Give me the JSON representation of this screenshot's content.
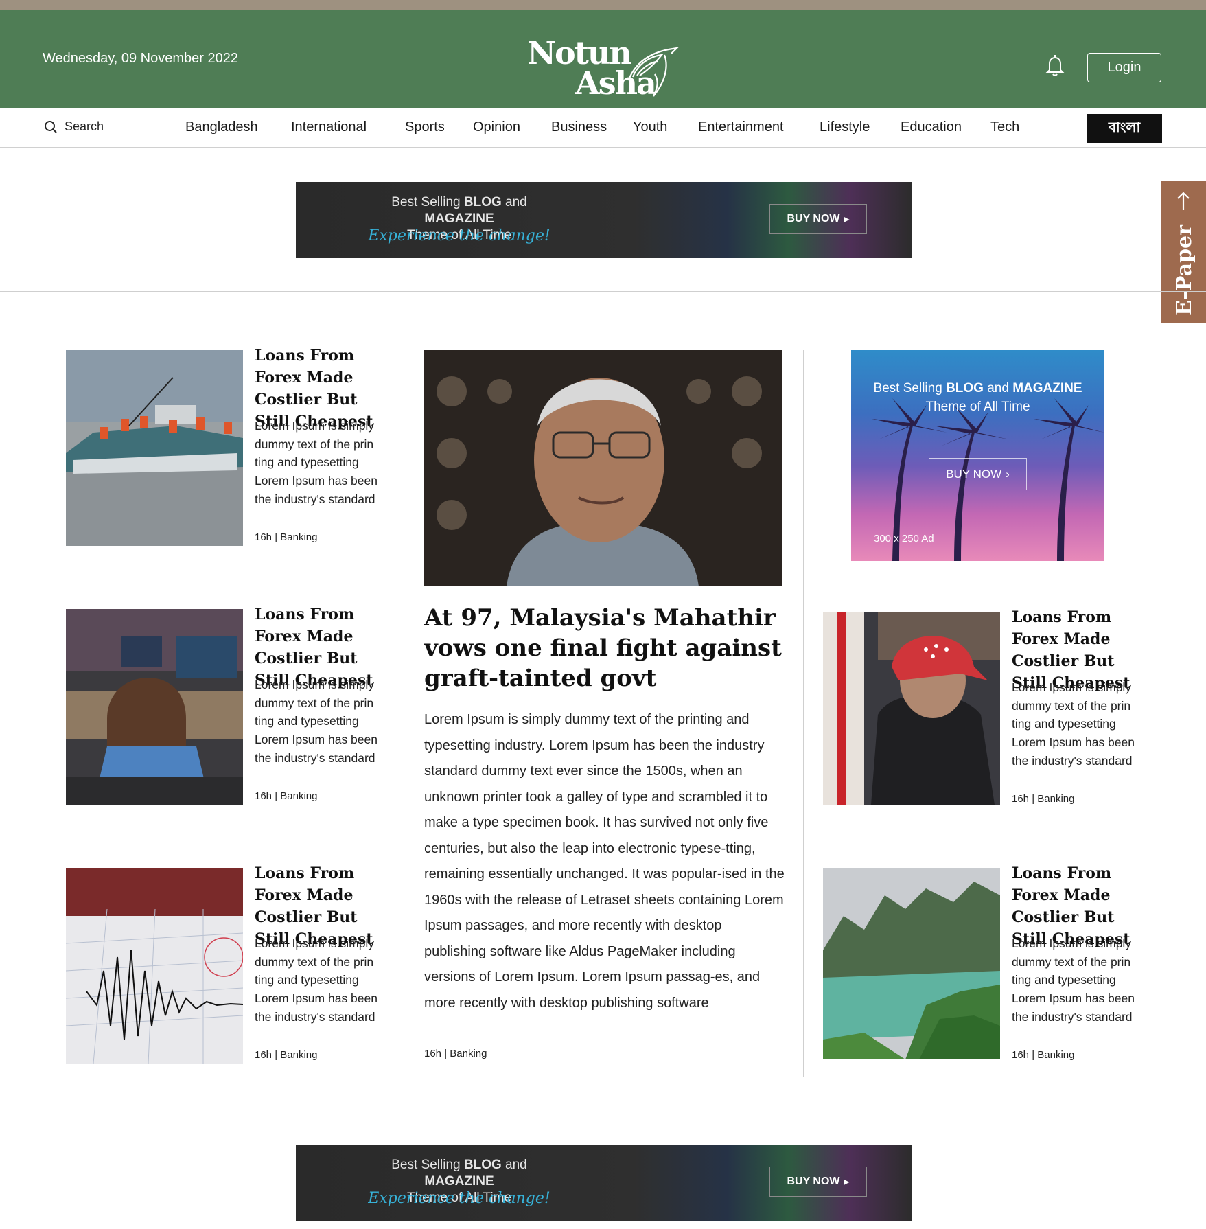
{
  "header": {
    "date": "Wednesday, 09 November 2022",
    "logo_line1": "Notun",
    "logo_line2": "Asha",
    "login_label": "Login",
    "bg_color": "#4f7d55"
  },
  "navbar": {
    "search_label": "Search",
    "items": [
      "Bangladesh",
      "International",
      "Sports",
      "Opinion",
      "Business",
      "Youth",
      "Entertainment",
      "Lifestyle",
      "Education",
      "Tech"
    ],
    "lang_button": "বাংলা"
  },
  "epaper": {
    "label": "E-Paper",
    "bg_color": "#9e6a4e"
  },
  "banner": {
    "line1_pre": "Best Selling ",
    "line1_b1": "BLOG",
    "line1_mid": " and ",
    "line1_b2": "MAGAZINE",
    "line2": "Theme of All Time",
    "tagline": "Experience the change!",
    "button": "BUY NOW"
  },
  "ad_300": {
    "line1_pre": "Best Selling ",
    "line1_b1": "BLOG",
    "line1_mid": " and ",
    "line1_b2": "MAGAZINE",
    "line2": "Theme of All Time",
    "button": "BUY NOW",
    "size_label": "300 x 250 Ad"
  },
  "lead": {
    "title": "At 97, Malaysia's Mahathir vows one final fight against graft-tainted govt",
    "body": "Lorem Ipsum is simply dummy text of the printing and typesetting industry. Lorem Ipsum has been the industry standard dummy text ever since the 1500s, when an unknown printer took a galley of type and scrambled it to make a type specimen book. It has survived not only five centuries, but also the leap into electronic typese-tting, remaining essentially unchanged. It was popular-ised in the 1960s with the release of Letraset sheets containing Lorem Ipsum passages, and more recently with desktop publishing software like Aldus PageMaker including versions of Lorem Ipsum. Lorem Ipsum passag-es, and more recently with desktop publishing software",
    "meta": "16h  |  Banking"
  },
  "cards": [
    {
      "title": "Loans From Forex Made Costlier But Still Cheapest",
      "excerpt": "Lorem Ipsum is simply dummy text of the prin ting  and typesetting Lorem Ipsum has been the industry's standard",
      "meta": "16h  |  Banking"
    },
    {
      "title": "Loans From Forex Made Costlier But Still Cheapest",
      "excerpt": "Lorem Ipsum is simply dummy text of the prin ting  and typesetting Lorem Ipsum has been the industry's standard",
      "meta": "16h  |  Banking"
    },
    {
      "title": "Loans From Forex Made Costlier But Still Cheapest",
      "excerpt": "Lorem Ipsum is simply dummy text of the prin ting  and typesetting Lorem Ipsum has been the industry's standard",
      "meta": "16h  |  Banking"
    },
    {
      "title": "Loans From Forex Made Costlier But Still Cheapest",
      "excerpt": "Lorem Ipsum is simply dummy text of the prin ting  and typesetting Lorem Ipsum has been the industry's standard",
      "meta": "16h  |  Banking"
    },
    {
      "title": "Loans From Forex Made Costlier But Still Cheapest",
      "excerpt": "Lorem Ipsum is simply dummy text of the prin ting  and typesetting Lorem Ipsum has been the industry's standard",
      "meta": "16h  |  Banking"
    }
  ]
}
